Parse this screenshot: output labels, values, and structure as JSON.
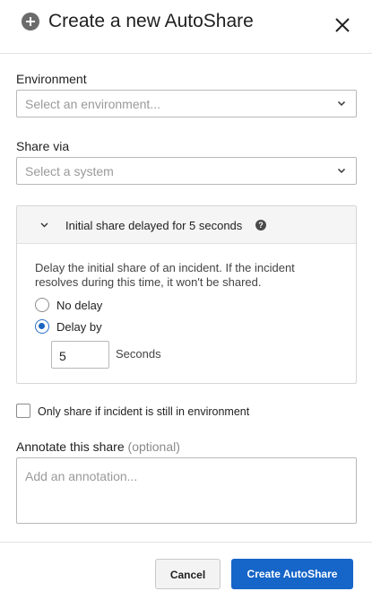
{
  "dialog": {
    "title": "Create a new AutoShare"
  },
  "environment": {
    "label": "Environment",
    "placeholder": "Select an environment..."
  },
  "share_via": {
    "label": "Share via",
    "placeholder": "Select a system"
  },
  "delay_panel": {
    "title": "Initial share delayed for 5 seconds",
    "help_glyph": "?",
    "description": "Delay the initial share of an incident. If the incident resolves during this time, it won't be shared.",
    "options": [
      {
        "label": "No delay",
        "selected": false
      },
      {
        "label": "Delay by",
        "selected": true
      }
    ],
    "delay_value": "5",
    "delay_unit": "Seconds"
  },
  "env_check": {
    "label": "Only share if incident is still in environment",
    "checked": false
  },
  "annotation": {
    "label": "Annotate this share",
    "optional_tag": "(optional)",
    "placeholder": "Add an annotation..."
  },
  "footer": {
    "cancel_label": "Cancel",
    "submit_label": "Create AutoShare"
  },
  "colors": {
    "primary": "#1665c8",
    "radio_selected": "#1c64c0"
  }
}
